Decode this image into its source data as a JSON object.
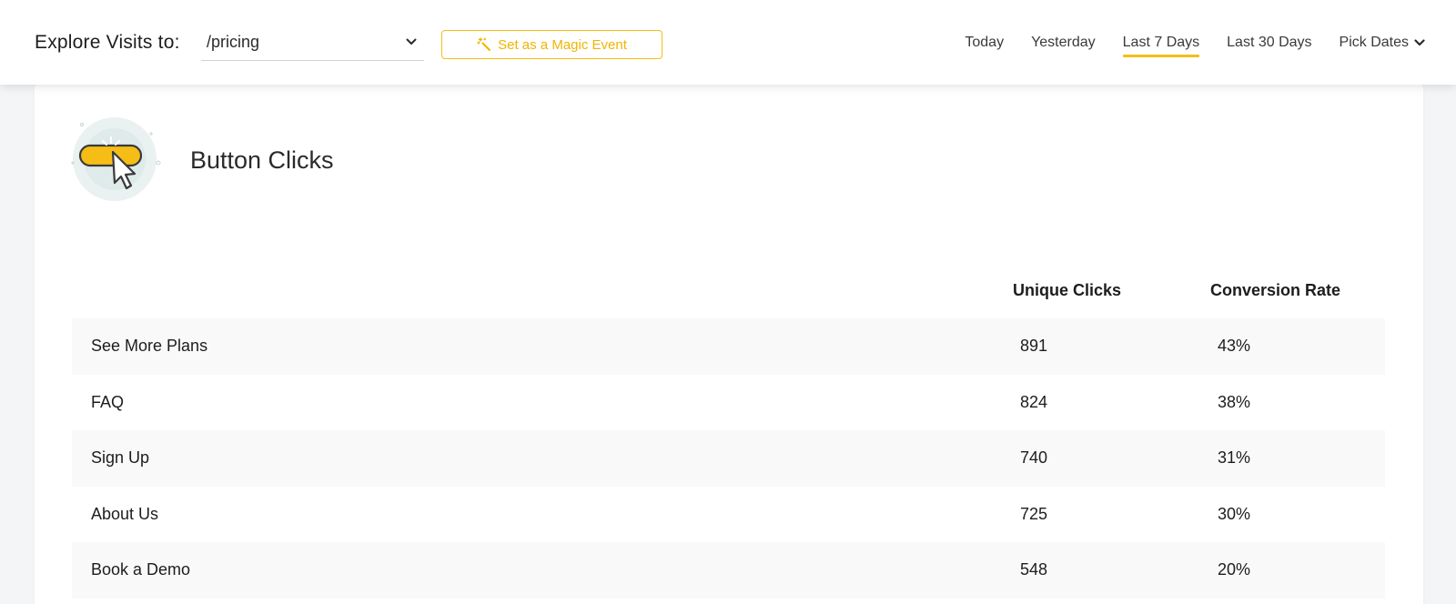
{
  "header": {
    "explore_label": "Explore Visits to:",
    "page_select": {
      "value": "/pricing",
      "icon": "chevron-down-icon"
    },
    "magic_button": {
      "label": "Set as a Magic Event",
      "icon": "magic-wand-icon",
      "color": "#f6bd16"
    },
    "date_ranges": [
      {
        "label": "Today",
        "active": false
      },
      {
        "label": "Yesterday",
        "active": false
      },
      {
        "label": "Last 7 Days",
        "active": true
      },
      {
        "label": "Last 30 Days",
        "active": false
      }
    ],
    "pick_dates": {
      "label": "Pick Dates",
      "icon": "chevron-down-icon"
    }
  },
  "card": {
    "title": "Button Clicks",
    "icon": "button-click-cursor-icon",
    "columns": {
      "clicks": "Unique Clicks",
      "rate": "Conversion Rate"
    },
    "rows": [
      {
        "name": "See More Plans",
        "clicks": "891",
        "rate": "43%"
      },
      {
        "name": "FAQ",
        "clicks": "824",
        "rate": "38%"
      },
      {
        "name": "Sign Up",
        "clicks": "740",
        "rate": "31%"
      },
      {
        "name": "About Us",
        "clicks": "725",
        "rate": "30%"
      },
      {
        "name": "Book a Demo",
        "clicks": "548",
        "rate": "20%"
      }
    ]
  },
  "colors": {
    "accent": "#f6bd16",
    "background": "#f4f5f6",
    "row_alt": "#f9f9f9"
  }
}
